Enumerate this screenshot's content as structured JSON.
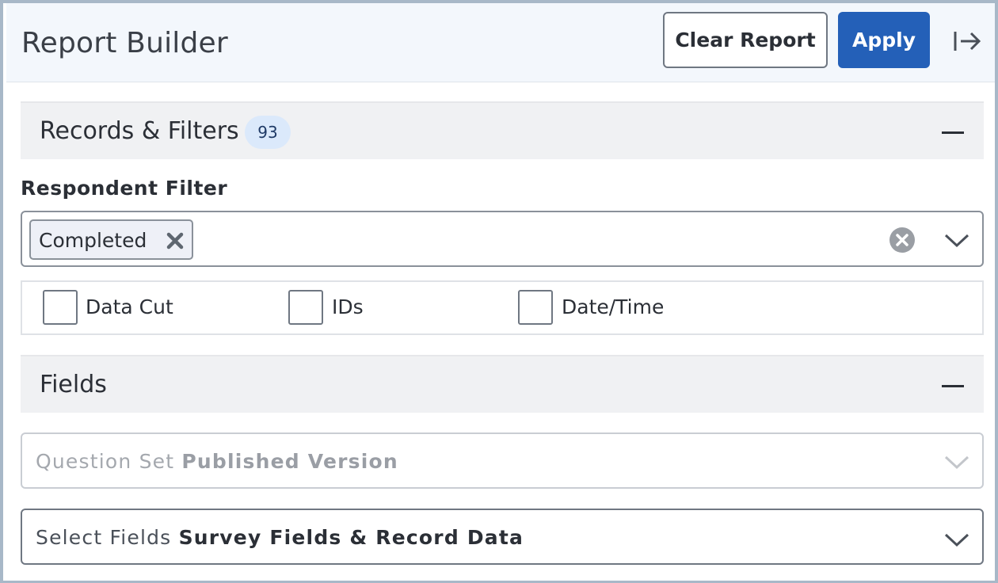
{
  "header": {
    "title": "Report Builder",
    "clear_label": "Clear Report",
    "apply_label": "Apply",
    "collapse_icon": "arrow-right-to-bar-icon"
  },
  "records_filters": {
    "title": "Records & Filters",
    "count": "93",
    "toggle_icon": "minus-icon"
  },
  "respondent_filter": {
    "label": "Respondent Filter",
    "selected": [
      "Completed"
    ],
    "clear_icon": "circle-x-icon",
    "dropdown_icon": "chevron-down-icon"
  },
  "options": {
    "data_cut": "Data Cut",
    "ids": "IDs",
    "date_time": "Date/Time"
  },
  "fields": {
    "title": "Fields",
    "toggle_icon": "minus-icon",
    "question_set_label": "Question Set",
    "question_set_value": "Published Version",
    "select_fields_label": "Select Fields",
    "select_fields_value": "Survey Fields & Record Data"
  },
  "colors": {
    "accent": "#2460b8",
    "header_bg": "#f3f7fc",
    "badge_bg": "#dbe9fb",
    "section_bg": "#f0f1f3"
  }
}
